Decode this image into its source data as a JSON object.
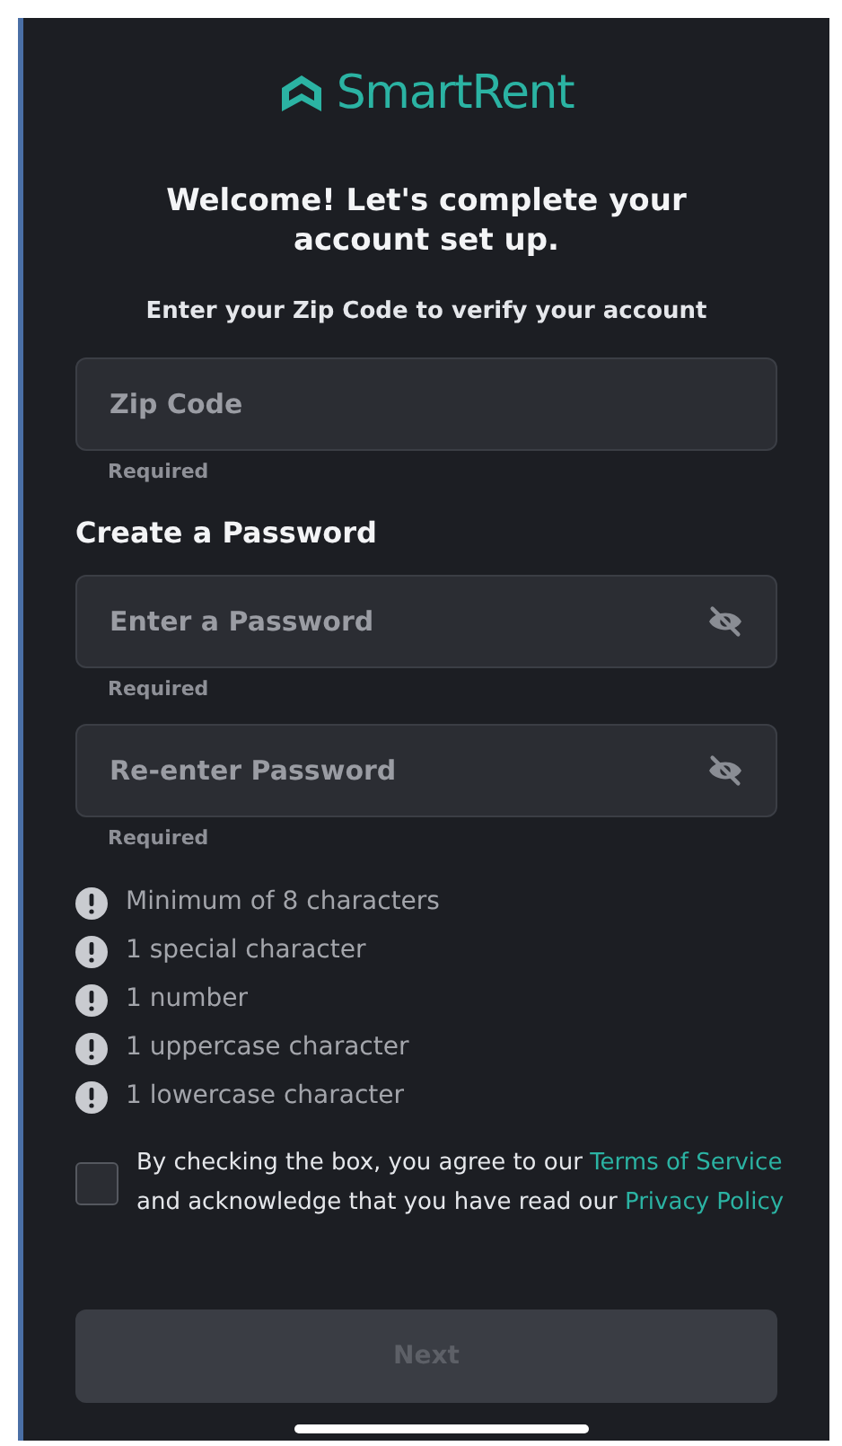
{
  "logo": {
    "name": "SmartRent"
  },
  "title": "Welcome! Let's complete your account set up.",
  "zip_prompt": "Enter your Zip Code to verify your account",
  "zip_field": {
    "placeholder": "Zip Code",
    "helper": "Required"
  },
  "password_heading": "Create a Password",
  "password_fields": [
    {
      "placeholder": "Enter a Password",
      "helper": "Required",
      "visible": false
    },
    {
      "placeholder": "Re-enter Password",
      "helper": "Required",
      "visible": false
    }
  ],
  "requirements": [
    {
      "label": "Minimum of 8 characters",
      "met": false
    },
    {
      "label": "1 special character",
      "met": false
    },
    {
      "label": "1 number",
      "met": false
    },
    {
      "label": "1 uppercase character",
      "met": false
    },
    {
      "label": "1 lowercase character",
      "met": false
    }
  ],
  "agreement": {
    "checked": false,
    "text_before": "By checking the box, you agree to our",
    "terms_link": "Terms of Service",
    "text_middle": "and acknowledge that you have read our",
    "privacy_link": "Privacy Policy"
  },
  "next_button": {
    "label": "Next",
    "disabled": true
  }
}
